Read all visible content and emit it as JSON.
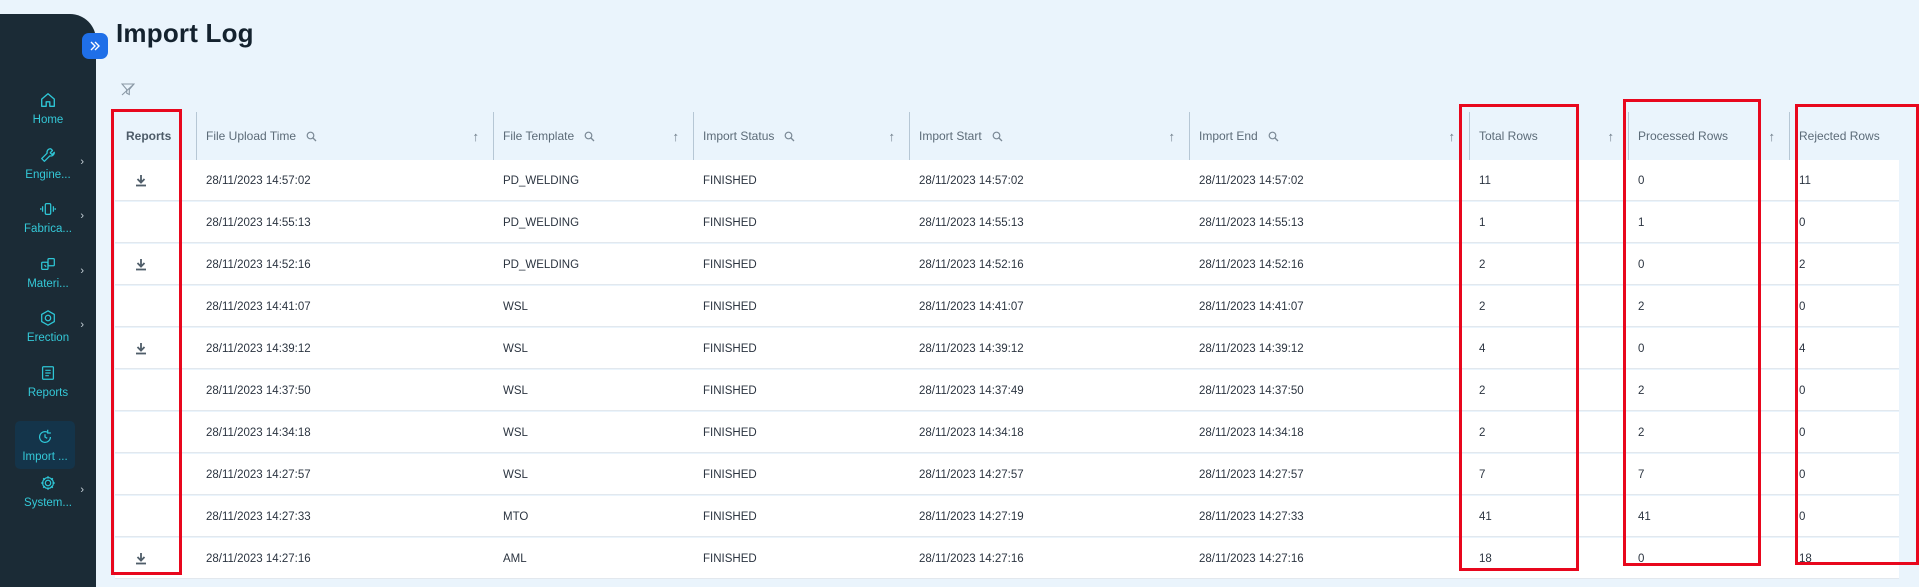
{
  "sidebar": {
    "items": [
      {
        "label": "Home",
        "icon": "home-icon",
        "has_submenu": false,
        "active": false
      },
      {
        "label": "Engine...",
        "icon": "wrench-icon",
        "has_submenu": true,
        "active": false
      },
      {
        "label": "Fabrica...",
        "icon": "fabrication-icon",
        "has_submenu": true,
        "active": false
      },
      {
        "label": "Materi...",
        "icon": "materials-icon",
        "has_submenu": true,
        "active": false
      },
      {
        "label": "Erection",
        "icon": "hex-nut-icon",
        "has_submenu": true,
        "active": false
      },
      {
        "label": "Reports",
        "icon": "report-icon",
        "has_submenu": false,
        "active": false
      },
      {
        "label": "Import ...",
        "icon": "import-history-icon",
        "has_submenu": false,
        "active": true
      },
      {
        "label": "System...",
        "icon": "gear-icon",
        "has_submenu": true,
        "active": false
      }
    ]
  },
  "page": {
    "title": "Import Log"
  },
  "table": {
    "columns": [
      {
        "label": "Reports",
        "searchable": false,
        "sortable": false
      },
      {
        "label": "File Upload Time",
        "searchable": true,
        "sortable": true
      },
      {
        "label": "File Template",
        "searchable": true,
        "sortable": true
      },
      {
        "label": "Import Status",
        "searchable": true,
        "sortable": true
      },
      {
        "label": "Import Start",
        "searchable": true,
        "sortable": true
      },
      {
        "label": "Import End",
        "searchable": true,
        "sortable": true
      },
      {
        "label": "Total Rows",
        "searchable": false,
        "sortable": true
      },
      {
        "label": "Processed Rows",
        "searchable": false,
        "sortable": true
      },
      {
        "label": "Rejected Rows",
        "searchable": false,
        "sortable": false
      }
    ],
    "rows": [
      {
        "download": true,
        "upload": "28/11/2023 14:57:02",
        "template": "PD_WELDING",
        "status": "FINISHED",
        "start": "28/11/2023 14:57:02",
        "end": "28/11/2023 14:57:02",
        "total": "11",
        "processed": "0",
        "rejected": "11"
      },
      {
        "download": false,
        "upload": "28/11/2023 14:55:13",
        "template": "PD_WELDING",
        "status": "FINISHED",
        "start": "28/11/2023 14:55:13",
        "end": "28/11/2023 14:55:13",
        "total": "1",
        "processed": "1",
        "rejected": "0"
      },
      {
        "download": true,
        "upload": "28/11/2023 14:52:16",
        "template": "PD_WELDING",
        "status": "FINISHED",
        "start": "28/11/2023 14:52:16",
        "end": "28/11/2023 14:52:16",
        "total": "2",
        "processed": "0",
        "rejected": "2"
      },
      {
        "download": false,
        "upload": "28/11/2023 14:41:07",
        "template": "WSL",
        "status": "FINISHED",
        "start": "28/11/2023 14:41:07",
        "end": "28/11/2023 14:41:07",
        "total": "2",
        "processed": "2",
        "rejected": "0"
      },
      {
        "download": true,
        "upload": "28/11/2023 14:39:12",
        "template": "WSL",
        "status": "FINISHED",
        "start": "28/11/2023 14:39:12",
        "end": "28/11/2023 14:39:12",
        "total": "4",
        "processed": "0",
        "rejected": "4"
      },
      {
        "download": false,
        "upload": "28/11/2023 14:37:50",
        "template": "WSL",
        "status": "FINISHED",
        "start": "28/11/2023 14:37:49",
        "end": "28/11/2023 14:37:50",
        "total": "2",
        "processed": "2",
        "rejected": "0"
      },
      {
        "download": false,
        "upload": "28/11/2023 14:34:18",
        "template": "WSL",
        "status": "FINISHED",
        "start": "28/11/2023 14:34:18",
        "end": "28/11/2023 14:34:18",
        "total": "2",
        "processed": "2",
        "rejected": "0"
      },
      {
        "download": false,
        "upload": "28/11/2023 14:27:57",
        "template": "WSL",
        "status": "FINISHED",
        "start": "28/11/2023 14:27:57",
        "end": "28/11/2023 14:27:57",
        "total": "7",
        "processed": "7",
        "rejected": "0"
      },
      {
        "download": false,
        "upload": "28/11/2023 14:27:33",
        "template": "MTO",
        "status": "FINISHED",
        "start": "28/11/2023 14:27:19",
        "end": "28/11/2023 14:27:33",
        "total": "41",
        "processed": "41",
        "rejected": "0"
      },
      {
        "download": true,
        "upload": "28/11/2023 14:27:16",
        "template": "AML",
        "status": "FINISHED",
        "start": "28/11/2023 14:27:16",
        "end": "28/11/2023 14:27:16",
        "total": "18",
        "processed": "0",
        "rejected": "18"
      }
    ]
  },
  "colors": {
    "sidebar_bg": "#1b2b36",
    "nav_text": "#34c9d8",
    "accent": "#1f6fe8",
    "highlight_box": "#e8071d",
    "page_bg": "#eaf4fc"
  }
}
